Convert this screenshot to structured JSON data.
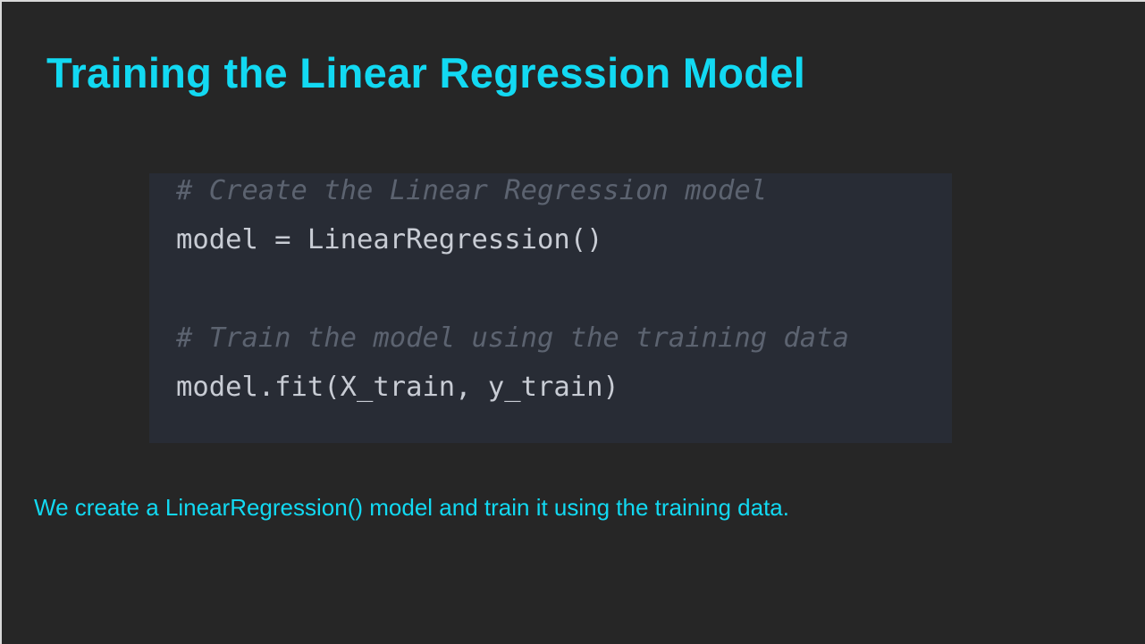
{
  "slide": {
    "title": "Training the Linear Regression Model",
    "code_lines": [
      "# Create the Linear Regression model",
      "model = LinearRegression()",
      "",
      "# Train the model using the training data",
      "model.fit(X_train, y_train)"
    ],
    "description": "We create a LinearRegression() model and train it using the training data.",
    "colors": {
      "background": "#262626",
      "accent": "#12d9f2",
      "code_bg": "#282c35",
      "comment": "#5c6370",
      "code_text": "#c8ccd4"
    }
  }
}
